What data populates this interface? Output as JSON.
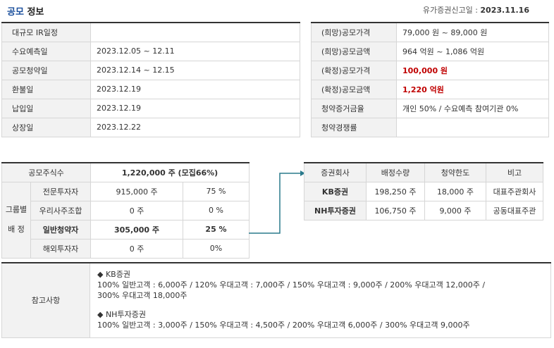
{
  "header": {
    "title_main": "공모",
    "title_sub": "정보",
    "report_date_label": "유가증권신고일 :",
    "report_date": "2023.11.16"
  },
  "schedule": [
    {
      "label": "대규모 IR일정",
      "value": ""
    },
    {
      "label": "수요예측일",
      "value": "2023.12.05 ~ 12.11"
    },
    {
      "label": "공모청약일",
      "value": "2023.12.14 ~ 12.15"
    },
    {
      "label": "환불일",
      "value": "2023.12.19"
    },
    {
      "label": "납입일",
      "value": "2023.12.19"
    },
    {
      "label": "상장일",
      "value": "2023.12.22"
    }
  ],
  "price": [
    {
      "label": "(희망)공모가격",
      "value": "79,000 원 ~ 89,000 원"
    },
    {
      "label": "(희망)공모금액",
      "value": "964 억원  ~ 1,086 억원"
    },
    {
      "label": "(확정)공모가격",
      "value": "100,000 원"
    },
    {
      "label": "(확정)공모금액",
      "value": "1,220 억원"
    },
    {
      "label": "청약증거금율",
      "value": "개인 50% / 수요예측 참여기관 0%"
    },
    {
      "label": "청약경쟁률",
      "value": ""
    }
  ],
  "allocation": {
    "total_label": "공모주식수",
    "total_value": "1,220,000 주 (모집66%)",
    "group_label_1": "그룹별",
    "group_label_2": "배 정",
    "rows": [
      {
        "name": "전문투자자",
        "shares": "915,000 주",
        "pct": "75 %"
      },
      {
        "name": "우리사주조합",
        "shares": "0 주",
        "pct": "0 %"
      },
      {
        "name": "일반청약자",
        "shares": "305,000 주",
        "pct": "25 %"
      },
      {
        "name": "해외투자자",
        "shares": "0 주",
        "pct": "0%"
      }
    ]
  },
  "underwriters": {
    "headers": [
      "증권회사",
      "배정수량",
      "청약한도",
      "비고"
    ],
    "rows": [
      {
        "name": "KB증권",
        "qty": "198,250 주",
        "limit": "18,000 주",
        "note": "대표주관회사"
      },
      {
        "name": "NH투자증권",
        "qty": "106,750 주",
        "limit": "9,000 주",
        "note": "공동대표주관"
      }
    ]
  },
  "reference": {
    "label": "참고사항",
    "kb_title": "◆ KB증권",
    "kb_line1": "100% 일반고객 : 6,000주 / 120% 우대고객 : 7,000주 / 150% 우대고객 : 9,000주 / 200% 우대고객 12,000주 /",
    "kb_line2": "300% 우대고객 18,000주",
    "nh_title": "◆ NH투자증권",
    "nh_line1": "100% 일반고객 : 3,000주 / 150% 우대고객 : 4,500주 / 200% 우대고객 6,000주 / 300% 우대고객 9,000주"
  },
  "colors": {
    "title_accent": "#1a4f9c",
    "highlight_red": "#c00000",
    "arrow": "#2a7a8c",
    "label_bg": "#f2f2f2"
  }
}
